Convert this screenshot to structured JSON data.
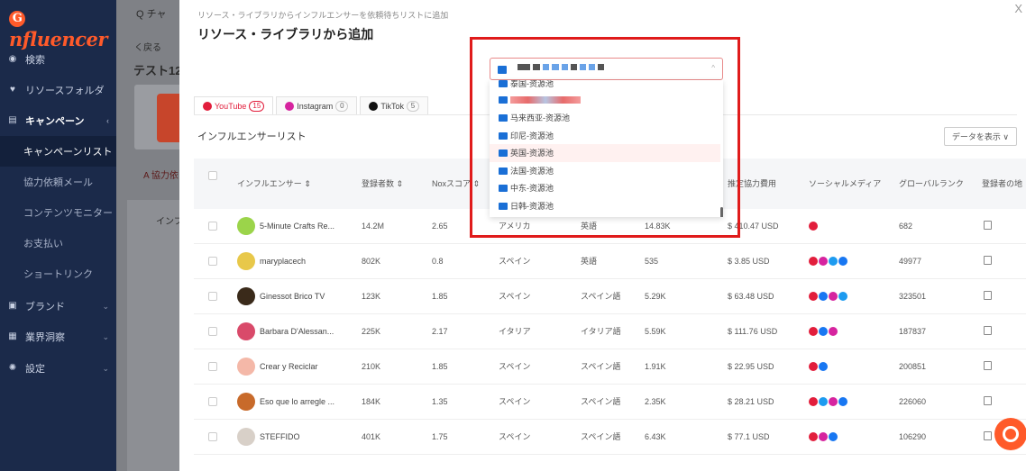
{
  "brand": {
    "logo_text": "nfluencer",
    "logo_glyph": "G",
    "accent": "#ff5a2a"
  },
  "sidebar": {
    "items": [
      {
        "label": "検索",
        "icon": "compass-icon"
      },
      {
        "label": "リソースフォルダ",
        "icon": "heart-icon"
      },
      {
        "label": "キャンペーン",
        "icon": "document-icon",
        "chevron": "‹"
      },
      {
        "label": "キャンペーンリスト"
      },
      {
        "label": "協力依頼メール"
      },
      {
        "label": "コンテンツモニター"
      },
      {
        "label": "お支払い"
      },
      {
        "label": "ショートリンク"
      },
      {
        "label": "ブランド",
        "icon": "brand-icon",
        "chevron": "⌄"
      },
      {
        "label": "業界洞察",
        "icon": "chart-icon",
        "chevron": "⌄"
      },
      {
        "label": "設定",
        "icon": "gear-icon",
        "chevron": "⌄"
      }
    ]
  },
  "background_page": {
    "search_text": "Q チャ",
    "back_text": "く戻る",
    "title_text": "テスト12",
    "tab_text": "A 協力依",
    "subtab_text": "インフ"
  },
  "drawer": {
    "breadcrumb": "リソース・ライブラリからインフルエンサーを依頼待ちリストに追加",
    "title": "リソース・ライブラリから追加",
    "close": "X",
    "tabs": [
      {
        "label": "YouTube",
        "count": "15",
        "color": "#e21e3c"
      },
      {
        "label": "Instagram",
        "count": "0",
        "color": "#d6249f"
      },
      {
        "label": "TikTok",
        "count": "5",
        "color": "#111111"
      }
    ],
    "list_title": "インフルエンサーリスト",
    "show_data_button": "データを表示 ∨"
  },
  "table": {
    "headers": [
      "インフルエンサー ⇕",
      "登録者数 ⇕",
      "Noxスコア ⇕",
      "推定協力費用",
      "ソーシャルメディア",
      "グローバルランク",
      "登録者の地"
    ],
    "rows": [
      {
        "name": "5-Minute Crafts Re...",
        "subs": "14.2M",
        "nox": "2.65",
        "country": "アメリカ",
        "lang": "英語",
        "views": "14.83K",
        "cost": "$ 410.47 USD",
        "social": [
          "yt"
        ],
        "rank": "682",
        "avatar": "#9bd44a"
      },
      {
        "name": "maryplacech",
        "subs": "802K",
        "nox": "0.8",
        "country": "スペイン",
        "lang": "英語",
        "views": "535",
        "cost": "$ 3.85 USD",
        "social": [
          "yt",
          "ig",
          "tw",
          "fb"
        ],
        "rank": "49977",
        "avatar": "#e8c84a"
      },
      {
        "name": "Ginessot Brico TV",
        "subs": "123K",
        "nox": "1.85",
        "country": "スペイン",
        "lang": "スペイン語",
        "views": "5.29K",
        "cost": "$ 63.48 USD",
        "social": [
          "yt",
          "fb",
          "ig",
          "tw"
        ],
        "rank": "323501",
        "avatar": "#3a2a1a"
      },
      {
        "name": "Barbara D'Alessan...",
        "subs": "225K",
        "nox": "2.17",
        "country": "イタリア",
        "lang": "イタリア語",
        "views": "5.59K",
        "cost": "$ 111.76 USD",
        "social": [
          "yt",
          "fb",
          "ig"
        ],
        "rank": "187837",
        "avatar": "#d94a6a"
      },
      {
        "name": "Crear y Reciclar",
        "subs": "210K",
        "nox": "1.85",
        "country": "スペイン",
        "lang": "スペイン語",
        "views": "1.91K",
        "cost": "$ 22.95 USD",
        "social": [
          "yt",
          "fb"
        ],
        "rank": "200851",
        "avatar": "#f4b8a8"
      },
      {
        "name": "Eso que lo arregle ...",
        "subs": "184K",
        "nox": "1.35",
        "country": "スペイン",
        "lang": "スペイン語",
        "views": "2.35K",
        "cost": "$ 28.21 USD",
        "social": [
          "yt",
          "tw",
          "ig",
          "fb"
        ],
        "rank": "226060",
        "avatar": "#c86a2a"
      },
      {
        "name": "STEFFIDO",
        "subs": "401K",
        "nox": "1.75",
        "country": "スペイン",
        "lang": "スペイン語",
        "views": "6.43K",
        "cost": "$ 77.1 USD",
        "social": [
          "yt",
          "ig",
          "fb"
        ],
        "rank": "106290",
        "avatar": "#d8d0c8"
      }
    ]
  },
  "dropdown": {
    "items": [
      {
        "label": "泰国-资源池",
        "highlighted": false,
        "blurred": false
      },
      {
        "label": "",
        "highlighted": false,
        "blurred": true
      },
      {
        "label": "马来西亚-资源池",
        "highlighted": false,
        "blurred": false
      },
      {
        "label": "印尼-资源池",
        "highlighted": false,
        "blurred": false
      },
      {
        "label": "英国-资源池",
        "highlighted": true,
        "blurred": false
      },
      {
        "label": "法国-资源池",
        "highlighted": false,
        "blurred": false
      },
      {
        "label": "中东-资源池",
        "highlighted": false,
        "blurred": false
      },
      {
        "label": "日韩-资源池",
        "highlighted": false,
        "blurred": false
      }
    ],
    "caret": "^"
  }
}
